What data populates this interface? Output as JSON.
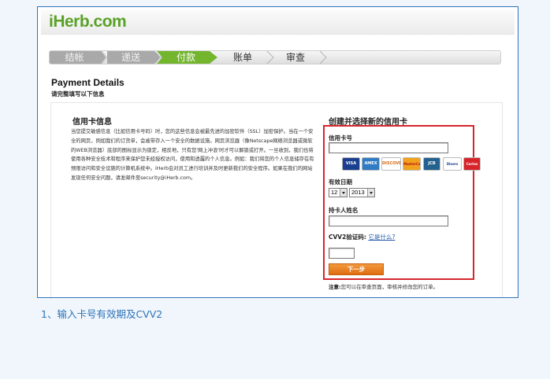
{
  "header": {
    "logo": "iHerb.com"
  },
  "checkout_steps": [
    {
      "label": "结帐",
      "state": "done"
    },
    {
      "label": "递送",
      "state": "done"
    },
    {
      "label": "付款",
      "state": "active"
    },
    {
      "label": "账单",
      "state": "todo"
    },
    {
      "label": "审查",
      "state": "todo"
    }
  ],
  "page": {
    "title": "Payment Details",
    "subtitle": "请完整填写以下信息"
  },
  "info": {
    "heading": "信用卡信息",
    "paragraph": "当您提交敏感信息（比如信用卡号码）时，您的这些信息会被最先进的加密软件（SSL）加密保护。当在一个安全的网页，例如我们的订货单，会被带存入一个安全的数据设施。网页浏览器（像Netscape网络浏览器或微软的WEB浏览器）底部的图标显示为锁定，相反地，只有您'网上冲浪'时才可以解锁或打开。一旦收到，我们也将使用各种安全技术和程序来保护您未经授权访问，使用和透露的个人信息。例如：我们将您的个人信息储存在有预限访问和安全设施的计算机系统中。iHerb会对员工进行培训并及时更新我们的安全程序。如果在我们的网站发现任何安全问题，请发邮件至security@iHerb.com。"
  },
  "form": {
    "heading": "创建并选择新的信用卡",
    "card_number_label": "信用卡号",
    "card_number_value": "",
    "card_logos": [
      "VISA",
      "AMEX",
      "DISCOVER",
      "MasterCard",
      "JCB",
      "Diners Club",
      "Cartes"
    ],
    "expiry_label": "有效日期",
    "expiry_month": "12",
    "expiry_year": "2013",
    "holder_label": "持卡人姓名",
    "holder_value": "",
    "cvv_label": "CVV2验证码:",
    "cvv_link": "它是什么?",
    "cvv_value": "",
    "next_button": "下一步",
    "note_prefix": "注意:",
    "note_text": "您可以在审查页面，审核并修改您的订单。"
  },
  "caption": "1、输入卡号有效期及CVV2",
  "colors": {
    "frame_border": "#2f73b9",
    "highlight_box": "#d6262d",
    "active_step": "#73b62e",
    "logo_green": "#5aa227",
    "button_orange": "#e06d10"
  }
}
